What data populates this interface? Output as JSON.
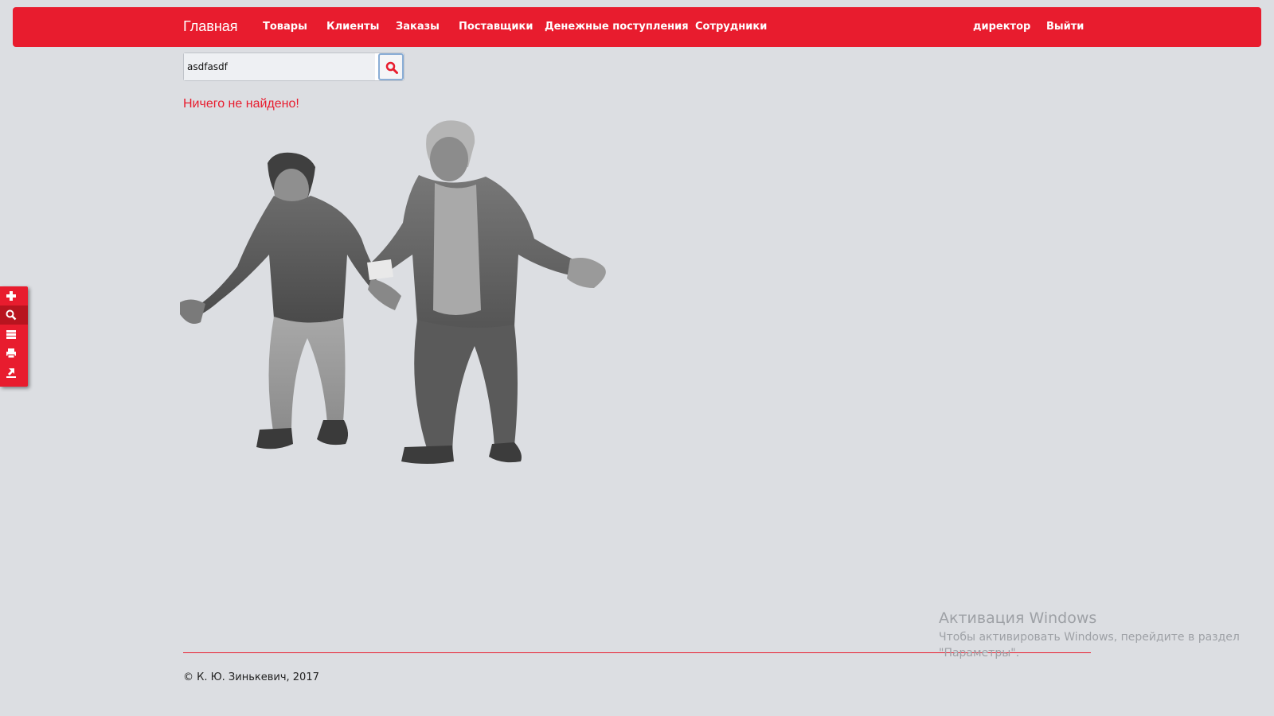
{
  "navbar": {
    "brand": "Главная",
    "links": [
      "Товары",
      "Клиенты",
      "Заказы",
      "Поставщики",
      "Денежные поступления",
      "Сотрудники"
    ],
    "user": "директор",
    "logout": "Выйти",
    "color": "#e81c2e"
  },
  "search": {
    "value": "asdfasdf",
    "button_icon": "search-icon"
  },
  "result": {
    "message": "Ничего не найдено!"
  },
  "side_toolbar": {
    "icons": [
      "plus-icon",
      "search-icon",
      "list-icon",
      "print-icon",
      "export-icon"
    ],
    "active": "search-icon"
  },
  "footer": {
    "copyright": "© К. Ю. Зинькевич, 2017"
  },
  "windows_activation": {
    "title": "Активация Windows",
    "text": "Чтобы активировать Windows, перейдите в раздел \"Параметры\"."
  }
}
